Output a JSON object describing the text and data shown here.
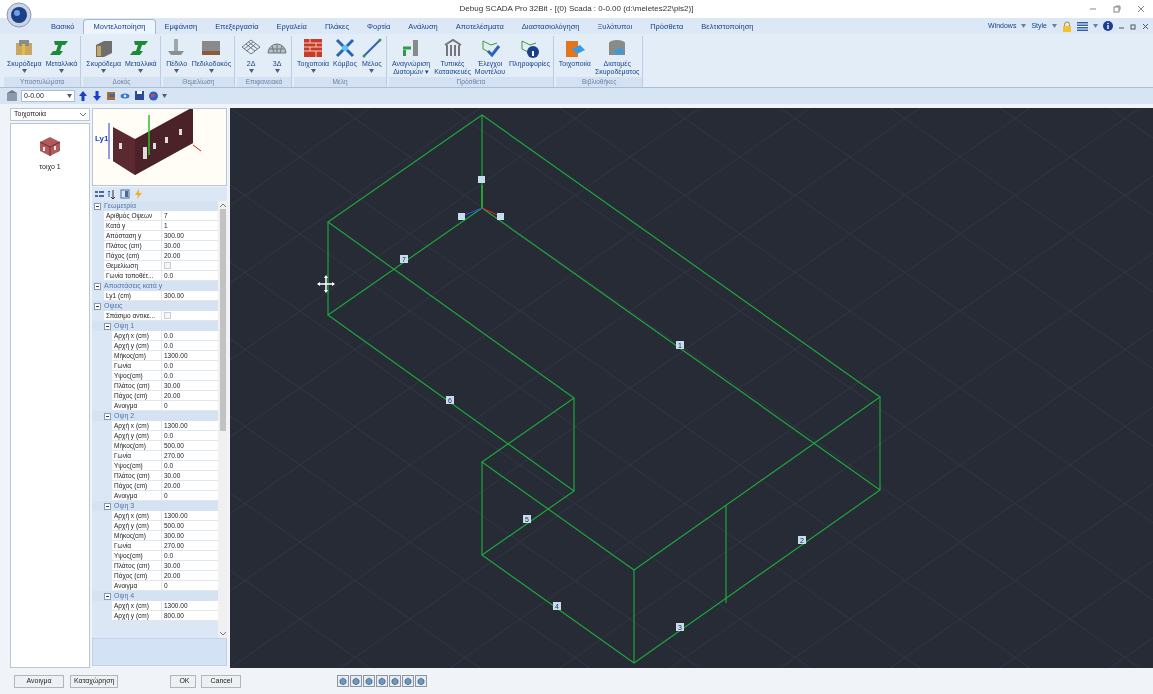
{
  "window": {
    "title": "Debug SCADA Pro 32Bit - [(0) Scada : 0-0.00 (d:\\meletes22\\pis2)]"
  },
  "tabs": [
    {
      "label": "Βασικό",
      "selected": false
    },
    {
      "label": "Μοντελοποίηση",
      "selected": true
    },
    {
      "label": "Εμφάνιση",
      "selected": false
    },
    {
      "label": "Επεξεργασία",
      "selected": false
    },
    {
      "label": "Εργαλεία",
      "selected": false
    },
    {
      "label": "Πλάκες",
      "selected": false
    },
    {
      "label": "Φορτία",
      "selected": false
    },
    {
      "label": "Ανάλυση",
      "selected": false
    },
    {
      "label": "Αποτελέσματα",
      "selected": false
    },
    {
      "label": "Διαστασιολόγηση",
      "selected": false
    },
    {
      "label": "Ξυλότυποι",
      "selected": false
    },
    {
      "label": "Πρόσθετα",
      "selected": false
    },
    {
      "label": "Βελτιστοποίηση",
      "selected": false
    }
  ],
  "tab_bar_right": {
    "windows_menu": "Windows",
    "style_menu": "Style"
  },
  "ribbon_groups": [
    {
      "label": "Υποστυλώματα",
      "buttons": [
        {
          "label": "Σκυρόδεμα",
          "dropdown": true
        },
        {
          "label": "Μεταλλικά",
          "dropdown": true
        }
      ]
    },
    {
      "label": "Δοκός",
      "buttons": [
        {
          "label": "Σκυρόδεμα",
          "dropdown": true
        },
        {
          "label": "Μεταλλικά",
          "dropdown": true
        }
      ]
    },
    {
      "label": "Θεμελίωση",
      "buttons": [
        {
          "label": "Πέδιλο",
          "dropdown": true
        },
        {
          "label": "Πεδιλοδοκός",
          "dropdown": true
        }
      ]
    },
    {
      "label": "Επιφανειακά",
      "buttons": [
        {
          "label": "2Δ",
          "dropdown": true
        },
        {
          "label": "3Δ",
          "dropdown": true
        }
      ]
    },
    {
      "label": "Μέλη",
      "buttons": [
        {
          "label": "Τοιχοποιία",
          "dropdown": true
        },
        {
          "label": "Κόμβος",
          "dropdown": false
        },
        {
          "label": "Μέλος",
          "dropdown": true
        }
      ]
    },
    {
      "label": "Πρόσθετα",
      "buttons": [
        {
          "label": "Αναγνώριση\nΔιατομών ▾",
          "dropdown": false
        },
        {
          "label": "Τυπικές\nΚατασκευές",
          "dropdown": false
        },
        {
          "label": "Έλεγχοι\nΜοντέλου",
          "dropdown": false
        },
        {
          "label": "Πληροφορίες",
          "dropdown": false
        }
      ]
    },
    {
      "label": "Βιβλιοθήκες",
      "buttons": [
        {
          "label": "Τοιχοποιία",
          "dropdown": false
        },
        {
          "label": "Διατομές\nΣκυροδέματος",
          "dropdown": false
        }
      ]
    }
  ],
  "quick_toolbar": {
    "level_value": "0-0.00"
  },
  "left_panel": {
    "category": "Τοιχοποιία",
    "items": [
      {
        "label": "τοιχο 1",
        "selected": false
      }
    ]
  },
  "preview": {
    "dimension_label": "Ly1"
  },
  "property_grid": {
    "categories": [
      {
        "title": "Γεωμετρία",
        "expanded": true,
        "rows": [
          {
            "kind": "text",
            "label": "Αριθμός Οψεων",
            "value": "7"
          },
          {
            "kind": "text",
            "label": "Κατά y",
            "value": "1"
          },
          {
            "kind": "text",
            "label": "Απόσταση y",
            "value": "300.00"
          },
          {
            "kind": "text",
            "label": "Πλάτος (cm)",
            "value": "30.00"
          },
          {
            "kind": "text",
            "label": "Πάχος (cm)",
            "value": "20.00"
          },
          {
            "kind": "checkbox",
            "label": "Θεμελίωση",
            "checked": false
          },
          {
            "kind": "text",
            "label": "Γωνία τοποθέτ...",
            "value": "0.0"
          }
        ]
      },
      {
        "title": "Αποστάσεις κατά y",
        "expanded": true,
        "rows": [
          {
            "kind": "text",
            "label": "Ly1 (cm)",
            "value": "300.00"
          }
        ]
      },
      {
        "title": "Οψεις",
        "expanded": true,
        "rows": [
          {
            "kind": "checkbox",
            "label": "Σπάσιμο αντικε...",
            "checked": false
          }
        ],
        "groups": [
          {
            "title": "Οψη 1",
            "expanded": true,
            "rows": [
              {
                "kind": "text",
                "label": "Αρχή x (cm)",
                "value": "0.0"
              },
              {
                "kind": "text",
                "label": "Αρχή y (cm)",
                "value": "0.0"
              },
              {
                "kind": "text",
                "label": "Μήκος(cm)",
                "value": "1300.00"
              },
              {
                "kind": "text",
                "label": "Γωνία",
                "value": "0.0"
              },
              {
                "kind": "text",
                "label": "Υψος(cm)",
                "value": "0.0"
              },
              {
                "kind": "text",
                "label": "Πλάτος (cm)",
                "value": "30.00"
              },
              {
                "kind": "text",
                "label": "Πάχος (cm)",
                "value": "20.00"
              },
              {
                "kind": "text",
                "label": "Ανοιγμα",
                "value": "0"
              }
            ]
          },
          {
            "title": "Οψη 2",
            "expanded": true,
            "rows": [
              {
                "kind": "text",
                "label": "Αρχή x (cm)",
                "value": "1300.00"
              },
              {
                "kind": "text",
                "label": "Αρχή y (cm)",
                "value": "0.0"
              },
              {
                "kind": "text",
                "label": "Μήκος(cm)",
                "value": "500.00"
              },
              {
                "kind": "text",
                "label": "Γωνία",
                "value": "270.00"
              },
              {
                "kind": "text",
                "label": "Υψος(cm)",
                "value": "0.0"
              },
              {
                "kind": "text",
                "label": "Πλάτος (cm)",
                "value": "30.00"
              },
              {
                "kind": "text",
                "label": "Πάχος (cm)",
                "value": "20.00"
              },
              {
                "kind": "text",
                "label": "Ανοιγμα",
                "value": "0"
              }
            ]
          },
          {
            "title": "Οψη 3",
            "expanded": true,
            "rows": [
              {
                "kind": "text",
                "label": "Αρχή x (cm)",
                "value": "1300.00"
              },
              {
                "kind": "text",
                "label": "Αρχή y (cm)",
                "value": "500.00"
              },
              {
                "kind": "text",
                "label": "Μήκος(cm)",
                "value": "300.00"
              },
              {
                "kind": "text",
                "label": "Γωνία",
                "value": "270.00"
              },
              {
                "kind": "text",
                "label": "Υψος(cm)",
                "value": "0.0"
              },
              {
                "kind": "text",
                "label": "Πλάτος (cm)",
                "value": "30.00"
              },
              {
                "kind": "text",
                "label": "Πάχος (cm)",
                "value": "20.00"
              },
              {
                "kind": "text",
                "label": "Ανοιγμα",
                "value": "0"
              }
            ]
          },
          {
            "title": "Οψη 4",
            "expanded": true,
            "rows": [
              {
                "kind": "text",
                "label": "Αρχή x (cm)",
                "value": "1300.00"
              },
              {
                "kind": "text",
                "label": "Αρχή y (cm)",
                "value": "800.00"
              }
            ]
          }
        ]
      }
    ]
  },
  "canvas": {
    "edge_labels": [
      "1",
      "2",
      "3",
      "4",
      "5",
      "6",
      "7"
    ]
  },
  "bottom_buttons": {
    "open": "Ανοιγμα",
    "save": "Καταχώρηση",
    "ok": "OK",
    "cancel": "Cancel"
  }
}
